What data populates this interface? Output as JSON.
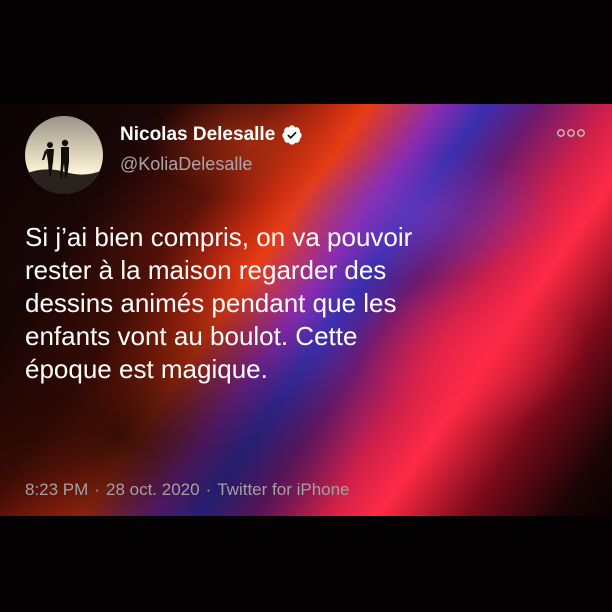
{
  "tweet": {
    "display_name": "Nicolas Delesalle",
    "handle": "@KoliaDelesalle",
    "verified": true,
    "lines": [
      "Si j’ai bien compris, on va pouvoir",
      "rester à la maison regarder des",
      "dessins animés pendant que les",
      "enfants vont au boulot. Cette",
      "époque est magique."
    ],
    "time": "8:23 PM",
    "date": "28 oct. 2020",
    "source": "Twitter for iPhone",
    "separator": "·"
  },
  "icons": {
    "verified": "verified-badge-icon",
    "more": "more-options-icon"
  },
  "colors": {
    "verified_badge": "#ffffff",
    "text": "#ffffff",
    "secondary_text": "#a79fa2"
  }
}
